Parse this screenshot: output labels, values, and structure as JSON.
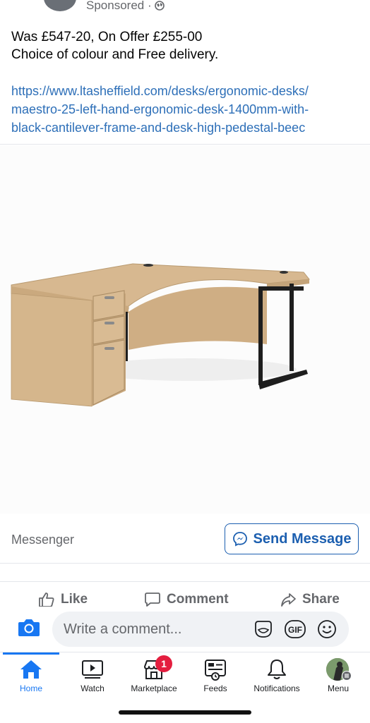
{
  "post": {
    "sponsored_label": "Sponsored · ",
    "text_line1": "Was £547-20, On Offer £255-00",
    "text_line2": "Choice of colour and Free delivery.",
    "link_line1": "https://www.ltasheffield.com/desks/ergonomic-desks/",
    "link_line2": "maestro-25-left-hand-ergonomic-desk-1400mm-with-",
    "link_line3": "black-cantilever-frame-and-desk-high-pedestal-beec"
  },
  "cta": {
    "messenger_label": "Messenger",
    "send_message_label": "Send Message"
  },
  "actions": {
    "like": "Like",
    "comment": "Comment",
    "share": "Share"
  },
  "comment_bar": {
    "placeholder": "Write a comment..."
  },
  "tabbar": {
    "home": "Home",
    "watch": "Watch",
    "marketplace": "Marketplace",
    "marketplace_badge": "1",
    "feeds": "Feeds",
    "notifications": "Notifications",
    "menu": "Menu"
  },
  "colors": {
    "brand_blue": "#1877f2",
    "link_blue": "#2d6fb8",
    "badge_red": "#e41e3f",
    "desk_wood": "#d8b98f"
  },
  "icons": [
    "globe-icon",
    "messenger-icon",
    "like-icon",
    "comment-icon",
    "share-icon",
    "camera-icon",
    "sticker-icon",
    "gif-icon",
    "emoji-icon",
    "home-icon",
    "watch-icon",
    "marketplace-icon",
    "feeds-icon",
    "notifications-icon"
  ]
}
